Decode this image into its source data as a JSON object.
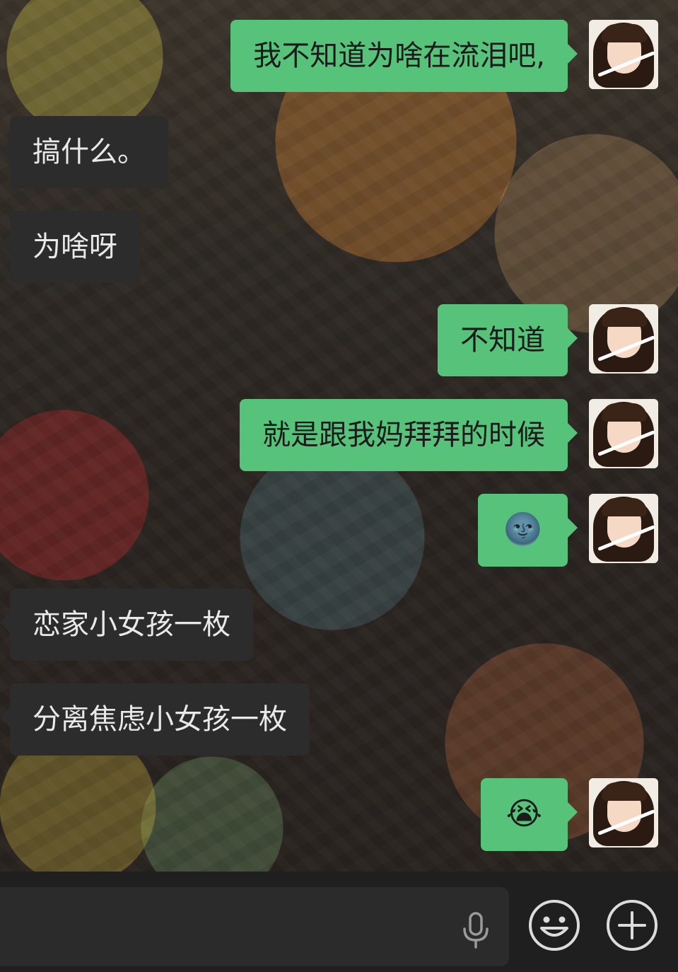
{
  "messages": [
    {
      "side": "right",
      "text": "我不知道为啥在流泪吧,"
    },
    {
      "side": "left",
      "text": "搞什么。"
    },
    {
      "side": "left",
      "text": "为啥呀"
    },
    {
      "side": "right",
      "text": "不知道"
    },
    {
      "side": "right",
      "text": "就是跟我妈拜拜的时候"
    },
    {
      "side": "right",
      "text": "🌚"
    },
    {
      "side": "left",
      "text": "恋家小女孩一枚"
    },
    {
      "side": "left",
      "text": "分离焦虑小女孩一枚"
    },
    {
      "side": "right",
      "text": "😭"
    }
  ],
  "input": {
    "value": "",
    "placeholder": ""
  },
  "icons": {
    "voice": "microphone-icon",
    "emoji": "emoji-face-icon",
    "more": "plus-icon"
  },
  "colors": {
    "outgoing_bubble": "#57c27a",
    "incoming_bubble": "#2c2c2c",
    "input_bar": "#1f1f1f"
  }
}
